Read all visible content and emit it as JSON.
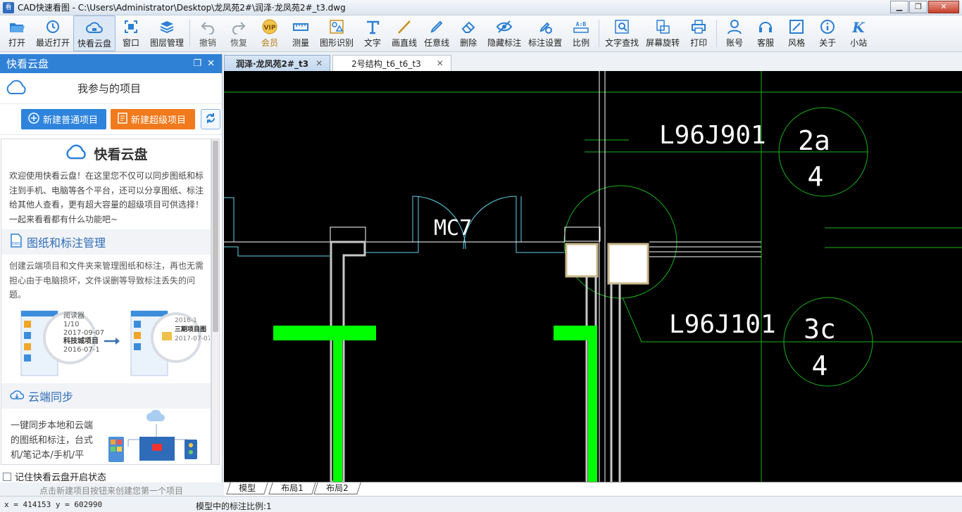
{
  "window": {
    "title": "CAD快速看图 - C:\\Users\\Administrator\\Desktop\\龙凤苑2#\\润泽·龙凤苑2#_t3.dwg"
  },
  "toolbar": {
    "items": [
      {
        "label": "打开",
        "icon": "folder-open-icon"
      },
      {
        "label": "最近打开",
        "icon": "history-icon"
      },
      {
        "label": "快看云盘",
        "icon": "cloud-icon"
      },
      {
        "label": "窗口",
        "icon": "window-icon"
      },
      {
        "label": "图层管理",
        "icon": "layers-icon"
      },
      {
        "label": "撤销",
        "icon": "undo-icon"
      },
      {
        "label": "恢复",
        "icon": "redo-icon"
      },
      {
        "label": "会员",
        "icon": "vip-icon"
      },
      {
        "label": "测量",
        "icon": "ruler-icon"
      },
      {
        "label": "图形识别",
        "icon": "shape-recognize-icon"
      },
      {
        "label": "文字",
        "icon": "text-icon"
      },
      {
        "label": "画直线",
        "icon": "line-icon"
      },
      {
        "label": "任意线",
        "icon": "pen-icon"
      },
      {
        "label": "删除",
        "icon": "eraser-icon"
      },
      {
        "label": "隐藏标注",
        "icon": "eye-hide-icon"
      },
      {
        "label": "标注设置",
        "icon": "annotation-settings-icon"
      },
      {
        "label": "比例",
        "icon": "scale-icon"
      },
      {
        "label": "文字查找",
        "icon": "text-search-icon"
      },
      {
        "label": "屏幕旋转",
        "icon": "rotate-screen-icon"
      },
      {
        "label": "打印",
        "icon": "printer-icon"
      },
      {
        "label": "账号",
        "icon": "user-icon"
      },
      {
        "label": "客服",
        "icon": "headset-icon"
      },
      {
        "label": "风格",
        "icon": "style-icon"
      },
      {
        "label": "关于",
        "icon": "info-icon"
      },
      {
        "label": "小站",
        "icon": "k-logo-icon"
      }
    ]
  },
  "panel": {
    "title": "快看云盘",
    "project_title": "我参与的项目",
    "btn_new_normal": "新建普通项目",
    "btn_new_super": "新建超级项目",
    "info_title": "快看云盘",
    "intro": "欢迎使用快看云盘！在这里您不仅可以同步图纸和标注到手机、电脑等各个平台，还可以分享图纸、标注给其他人查看，更有超大容量的超级项目可供选择！一起来看看都有什么功能吧~",
    "section1_title": "图纸和标注管理",
    "section1_text": "创建云端项目和文件夹来管理图纸和标注，再也无需担心由于电脑损坏，文件误删等导致标注丢失的问题。",
    "illus_left": {
      "line1": "阅读器",
      "line2": "1/10",
      "line3": "2017-09-07",
      "line4": "科技城项目",
      "line5": "2016-07-1"
    },
    "illus_right": {
      "line1": "2016-1",
      "line2": "三期项目图",
      "line3": "2017-07-07"
    },
    "section2_title": "云端同步",
    "section2_text": "一键同步本地和云端的图纸和标注，台式机/笔记本/手机/平板，各个平台图纸标",
    "remember_label": "记住快看云盘开启状态",
    "hint": "点击新建项目按钮来创建您第一个项目"
  },
  "tabs": [
    {
      "label": "润泽·龙凤苑2#_t3",
      "active": true
    },
    {
      "label": "2号结构_t6_t6_t3",
      "active": false
    }
  ],
  "drawing": {
    "labels": [
      "L96J901",
      "L96J101",
      "MC7"
    ],
    "bubbles": [
      {
        "top": "2a",
        "bottom": "4"
      },
      {
        "top": "3c",
        "bottom": "4"
      }
    ],
    "colors": {
      "background": "#000000",
      "green": "#00ff00",
      "cyan": "#5fd3e8",
      "white": "#ffffff",
      "grid_green": "#19b319"
    }
  },
  "layout_tabs": [
    "模型",
    "布局1",
    "布局2"
  ],
  "status": {
    "coords": "x = 414153  y = 602990",
    "scale": "模型中的标注比例:1"
  }
}
